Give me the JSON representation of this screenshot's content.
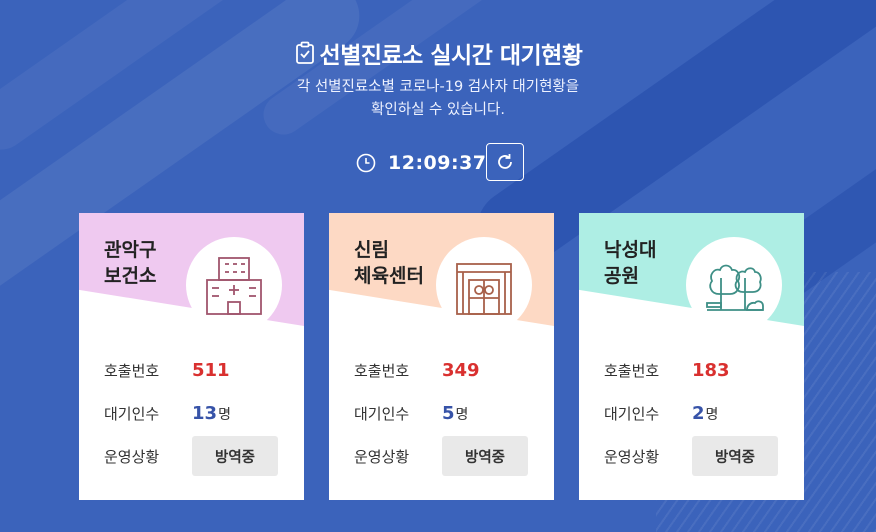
{
  "header": {
    "title": "선별진료소 실시간 대기현황",
    "subtitle_line1": "각 선별진료소별 코로나-19 검사자 대기현황을",
    "subtitle_line2": "확인하실 수 있습니다."
  },
  "clock": {
    "time": "12:09:37"
  },
  "labels": {
    "call_number": "호출번호",
    "waiting": "대기인수",
    "status": "운영상황",
    "unit": "명"
  },
  "sites": [
    {
      "name_line1": "관악구",
      "name_line2": "보건소",
      "call_number": "511",
      "waiting": "13",
      "status": "방역중",
      "color": "#efc9f0",
      "icon": "hospital-icon"
    },
    {
      "name_line1": "신림",
      "name_line2": "체육센터",
      "call_number": "349",
      "waiting": "5",
      "status": "방역중",
      "color": "#fdd9c4",
      "icon": "gym-building-icon"
    },
    {
      "name_line1": "낙성대",
      "name_line2": "공원",
      "call_number": "183",
      "waiting": "2",
      "status": "방역중",
      "color": "#aeeee4",
      "icon": "park-trees-icon"
    }
  ]
}
